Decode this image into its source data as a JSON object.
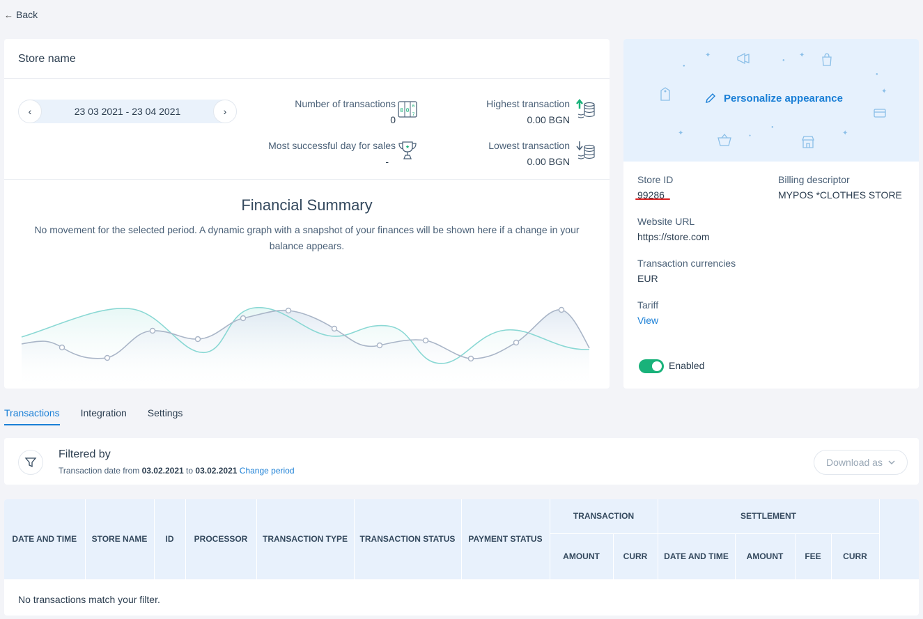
{
  "back_label": "Back",
  "store": {
    "name": "Store name",
    "date_range": "23 03 2021 - 23 04 2021",
    "stats": {
      "num_transactions_label": "Number of transactions",
      "num_transactions_value": "0",
      "highest_label": "Highest transaction",
      "highest_value": "0.00 BGN",
      "best_day_label": "Most successful day for sales",
      "best_day_value": "-",
      "lowest_label": "Lowest transaction",
      "lowest_value": "0.00 BGN"
    },
    "financial_summary": {
      "title": "Financial Summary",
      "description": "No movement for the selected period. A dynamic graph with a snapshot of your finances will be shown here if a change in your balance appears."
    }
  },
  "details": {
    "personalize_label": "Personalize appearance",
    "store_id_label": "Store ID",
    "store_id_value": "99286",
    "billing_label": "Billing descriptor",
    "billing_value": "MYPOS *CLOTHES STORE",
    "website_label": "Website URL",
    "website_value": "https://store.com",
    "currencies_label": "Transaction currencies",
    "currencies_value": "EUR",
    "tariff_label": "Tariff",
    "tariff_link": "View",
    "enabled_label": "Enabled"
  },
  "tabs": [
    {
      "label": "Transactions",
      "active": true
    },
    {
      "label": "Integration",
      "active": false
    },
    {
      "label": "Settings",
      "active": false
    }
  ],
  "filter": {
    "title": "Filtered by",
    "prefix": "Transaction date from",
    "from": "03.02.2021",
    "to_word": "to",
    "to": "03.02.2021",
    "change_link": "Change period",
    "download_label": "Download as"
  },
  "table": {
    "headers": {
      "date_time": "Date and time",
      "store_name": "Store name",
      "id": "ID",
      "processor": "Processor",
      "tx_type": "Transaction type",
      "tx_status": "Transaction status",
      "payment_status": "Payment status",
      "transaction_group": "Transaction",
      "settlement_group": "Settlement",
      "amount": "Amount",
      "curr": "Curr",
      "s_date_time": "Date and time",
      "s_amount": "Amount",
      "fee": "Fee",
      "s_curr": "Curr"
    },
    "empty_message": "No transactions match your filter."
  },
  "colors": {
    "accent": "#1a7fd6",
    "toggle_on": "#19b27a",
    "highlight_underline": "#d91e1e"
  }
}
